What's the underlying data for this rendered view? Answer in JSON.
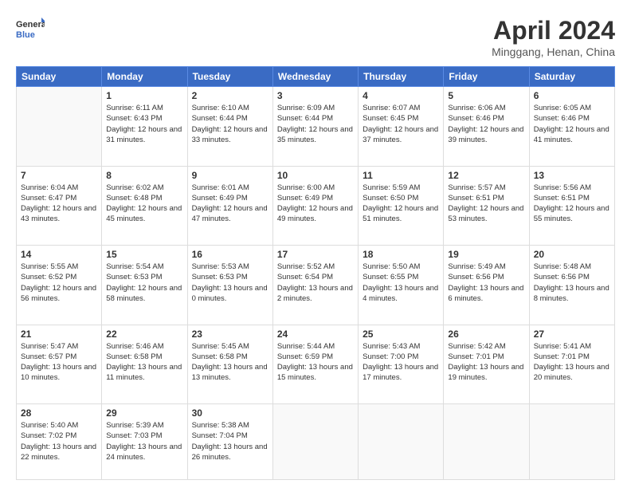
{
  "header": {
    "logo_line1": "General",
    "logo_line2": "Blue",
    "title": "April 2024",
    "location": "Minggang, Henan, China"
  },
  "weekdays": [
    "Sunday",
    "Monday",
    "Tuesday",
    "Wednesday",
    "Thursday",
    "Friday",
    "Saturday"
  ],
  "weeks": [
    [
      {
        "day": "",
        "info": ""
      },
      {
        "day": "1",
        "info": "Sunrise: 6:11 AM\nSunset: 6:43 PM\nDaylight: 12 hours\nand 31 minutes."
      },
      {
        "day": "2",
        "info": "Sunrise: 6:10 AM\nSunset: 6:44 PM\nDaylight: 12 hours\nand 33 minutes."
      },
      {
        "day": "3",
        "info": "Sunrise: 6:09 AM\nSunset: 6:44 PM\nDaylight: 12 hours\nand 35 minutes."
      },
      {
        "day": "4",
        "info": "Sunrise: 6:07 AM\nSunset: 6:45 PM\nDaylight: 12 hours\nand 37 minutes."
      },
      {
        "day": "5",
        "info": "Sunrise: 6:06 AM\nSunset: 6:46 PM\nDaylight: 12 hours\nand 39 minutes."
      },
      {
        "day": "6",
        "info": "Sunrise: 6:05 AM\nSunset: 6:46 PM\nDaylight: 12 hours\nand 41 minutes."
      }
    ],
    [
      {
        "day": "7",
        "info": "Sunrise: 6:04 AM\nSunset: 6:47 PM\nDaylight: 12 hours\nand 43 minutes."
      },
      {
        "day": "8",
        "info": "Sunrise: 6:02 AM\nSunset: 6:48 PM\nDaylight: 12 hours\nand 45 minutes."
      },
      {
        "day": "9",
        "info": "Sunrise: 6:01 AM\nSunset: 6:49 PM\nDaylight: 12 hours\nand 47 minutes."
      },
      {
        "day": "10",
        "info": "Sunrise: 6:00 AM\nSunset: 6:49 PM\nDaylight: 12 hours\nand 49 minutes."
      },
      {
        "day": "11",
        "info": "Sunrise: 5:59 AM\nSunset: 6:50 PM\nDaylight: 12 hours\nand 51 minutes."
      },
      {
        "day": "12",
        "info": "Sunrise: 5:57 AM\nSunset: 6:51 PM\nDaylight: 12 hours\nand 53 minutes."
      },
      {
        "day": "13",
        "info": "Sunrise: 5:56 AM\nSunset: 6:51 PM\nDaylight: 12 hours\nand 55 minutes."
      }
    ],
    [
      {
        "day": "14",
        "info": "Sunrise: 5:55 AM\nSunset: 6:52 PM\nDaylight: 12 hours\nand 56 minutes."
      },
      {
        "day": "15",
        "info": "Sunrise: 5:54 AM\nSunset: 6:53 PM\nDaylight: 12 hours\nand 58 minutes."
      },
      {
        "day": "16",
        "info": "Sunrise: 5:53 AM\nSunset: 6:53 PM\nDaylight: 13 hours\nand 0 minutes."
      },
      {
        "day": "17",
        "info": "Sunrise: 5:52 AM\nSunset: 6:54 PM\nDaylight: 13 hours\nand 2 minutes."
      },
      {
        "day": "18",
        "info": "Sunrise: 5:50 AM\nSunset: 6:55 PM\nDaylight: 13 hours\nand 4 minutes."
      },
      {
        "day": "19",
        "info": "Sunrise: 5:49 AM\nSunset: 6:56 PM\nDaylight: 13 hours\nand 6 minutes."
      },
      {
        "day": "20",
        "info": "Sunrise: 5:48 AM\nSunset: 6:56 PM\nDaylight: 13 hours\nand 8 minutes."
      }
    ],
    [
      {
        "day": "21",
        "info": "Sunrise: 5:47 AM\nSunset: 6:57 PM\nDaylight: 13 hours\nand 10 minutes."
      },
      {
        "day": "22",
        "info": "Sunrise: 5:46 AM\nSunset: 6:58 PM\nDaylight: 13 hours\nand 11 minutes."
      },
      {
        "day": "23",
        "info": "Sunrise: 5:45 AM\nSunset: 6:58 PM\nDaylight: 13 hours\nand 13 minutes."
      },
      {
        "day": "24",
        "info": "Sunrise: 5:44 AM\nSunset: 6:59 PM\nDaylight: 13 hours\nand 15 minutes."
      },
      {
        "day": "25",
        "info": "Sunrise: 5:43 AM\nSunset: 7:00 PM\nDaylight: 13 hours\nand 17 minutes."
      },
      {
        "day": "26",
        "info": "Sunrise: 5:42 AM\nSunset: 7:01 PM\nDaylight: 13 hours\nand 19 minutes."
      },
      {
        "day": "27",
        "info": "Sunrise: 5:41 AM\nSunset: 7:01 PM\nDaylight: 13 hours\nand 20 minutes."
      }
    ],
    [
      {
        "day": "28",
        "info": "Sunrise: 5:40 AM\nSunset: 7:02 PM\nDaylight: 13 hours\nand 22 minutes."
      },
      {
        "day": "29",
        "info": "Sunrise: 5:39 AM\nSunset: 7:03 PM\nDaylight: 13 hours\nand 24 minutes."
      },
      {
        "day": "30",
        "info": "Sunrise: 5:38 AM\nSunset: 7:04 PM\nDaylight: 13 hours\nand 26 minutes."
      },
      {
        "day": "",
        "info": ""
      },
      {
        "day": "",
        "info": ""
      },
      {
        "day": "",
        "info": ""
      },
      {
        "day": "",
        "info": ""
      }
    ]
  ]
}
